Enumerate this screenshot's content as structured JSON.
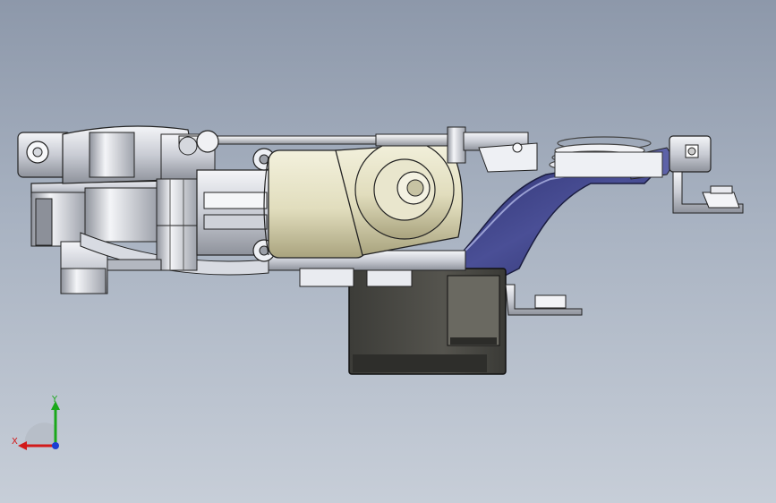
{
  "viewport": {
    "background_top": "#8d98aa",
    "background_bottom": "#c7ced8"
  },
  "model": {
    "description_icon": "cad-assembly",
    "colors": {
      "metal_light": "#e6e8ee",
      "metal_mid": "#b9bdc8",
      "metal_dark": "#5a5e66",
      "motor_cream": "#e8e4c8",
      "motor_shade": "#b8b38f",
      "housing_dark": "#3f3f3b",
      "housing_face": "#5b5a54",
      "strap_blue": "#3b3f82",
      "strap_light": "#8a8fc2"
    }
  },
  "triad": {
    "x_label": "X",
    "y_label": "Y",
    "x_color": "#d21a1a",
    "y_color": "#1aa81a",
    "z_color": "#1a3fd2"
  }
}
